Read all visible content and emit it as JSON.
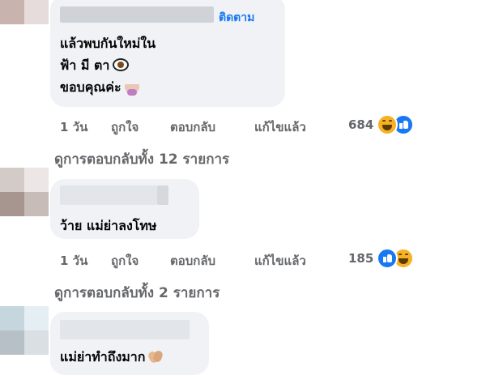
{
  "comments": [
    {
      "follow_label": "ติดตาม",
      "lines": [
        "แล้วพบกันใหม่ใน",
        "ฟ้า มี ตา",
        "ขอบคุณค่ะ"
      ],
      "actions": {
        "time": "1 วัน",
        "like": "ถูกใจ",
        "reply": "ตอบกลับ",
        "edited": "แก้ไขแล้ว"
      },
      "reaction_count": "684",
      "reaction_icons": [
        "haha",
        "like"
      ],
      "view_replies": "ดูการตอบกลับทั้ง 12 รายการ"
    },
    {
      "lines": [
        "ว้าย แม่ย่าลงโทษ"
      ],
      "actions": {
        "time": "1 วัน",
        "like": "ถูกใจ",
        "reply": "ตอบกลับ",
        "edited": "แก้ไขแล้ว"
      },
      "reaction_count": "185",
      "reaction_icons": [
        "like",
        "haha"
      ],
      "view_replies": "ดูการตอบกลับทั้ง 2 รายการ"
    },
    {
      "lines": [
        "แม่ย่าทำถึงมาก"
      ]
    }
  ],
  "colors": {
    "bubble": "#f0f2f5",
    "link": "#1877f2",
    "meta": "#65676b",
    "text": "#050505"
  },
  "emoji_names": [
    "eye-emoji",
    "person-tipping-hand-emoji",
    "clapping-hands-emoji",
    "haha-reaction-icon",
    "like-reaction-icon"
  ]
}
